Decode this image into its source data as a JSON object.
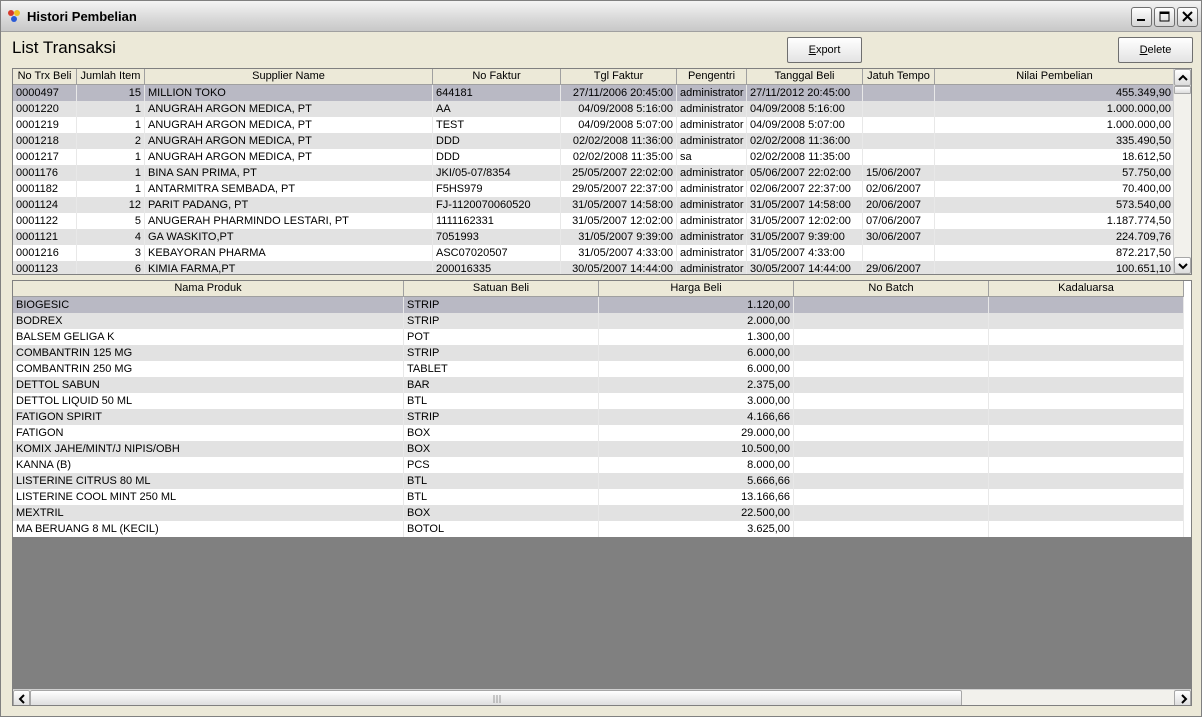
{
  "window": {
    "title": "Histori Pembelian"
  },
  "page": {
    "heading": "List Transaksi"
  },
  "buttons": {
    "export_label": "Export",
    "delete_label": "Delete"
  },
  "transactions": {
    "columns": [
      "No Trx Beli",
      "Jumlah Item",
      "Supplier Name",
      "No Faktur",
      "Tgl Faktur",
      "Pengentri",
      "Tanggal Beli",
      "Jatuh Tempo",
      "Nilai Pembelian"
    ],
    "rows": [
      [
        "0000497",
        "15",
        "MILLION TOKO",
        "644181",
        "27/11/2006 20:45:00",
        "administrator",
        "27/11/2012 20:45:00",
        "",
        "455.349,90"
      ],
      [
        "0001220",
        "1",
        "ANUGRAH ARGON MEDICA, PT",
        "AA",
        "04/09/2008 5:16:00",
        "administrator",
        "04/09/2008 5:16:00",
        "",
        "1.000.000,00"
      ],
      [
        "0001219",
        "1",
        "ANUGRAH ARGON MEDICA, PT",
        "TEST",
        "04/09/2008 5:07:00",
        "administrator",
        "04/09/2008 5:07:00",
        "",
        "1.000.000,00"
      ],
      [
        "0001218",
        "2",
        "ANUGRAH ARGON MEDICA, PT",
        "DDD",
        "02/02/2008 11:36:00",
        "administrator",
        "02/02/2008 11:36:00",
        "",
        "335.490,50"
      ],
      [
        "0001217",
        "1",
        "ANUGRAH ARGON MEDICA, PT",
        "DDD",
        "02/02/2008 11:35:00",
        "sa",
        "02/02/2008 11:35:00",
        "",
        "18.612,50"
      ],
      [
        "0001176",
        "1",
        "BINA SAN PRIMA, PT",
        "JKI/05-07/8354",
        "25/05/2007 22:02:00",
        "administrator",
        "05/06/2007 22:02:00",
        "15/06/2007",
        "57.750,00"
      ],
      [
        "0001182",
        "1",
        "ANTARMITRA SEMBADA, PT",
        "F5HS979",
        "29/05/2007 22:37:00",
        "administrator",
        "02/06/2007 22:37:00",
        "02/06/2007",
        "70.400,00"
      ],
      [
        "0001124",
        "12",
        "PARIT PADANG, PT",
        "FJ-1120070060520",
        "31/05/2007 14:58:00",
        "administrator",
        "31/05/2007 14:58:00",
        "20/06/2007",
        "573.540,00"
      ],
      [
        "0001122",
        "5",
        "ANUGERAH PHARMINDO LESTARI, PT",
        "1111162331",
        "31/05/2007 12:02:00",
        "administrator",
        "31/05/2007 12:02:00",
        "07/06/2007",
        "1.187.774,50"
      ],
      [
        "0001121",
        "4",
        "GA WASKITO,PT",
        "7051993",
        "31/05/2007 9:39:00",
        "administrator",
        "31/05/2007 9:39:00",
        "30/06/2007",
        "224.709,76"
      ],
      [
        "0001216",
        "3",
        "KEBAYORAN PHARMA",
        "ASC07020507",
        "31/05/2007 4:33:00",
        "administrator",
        "31/05/2007 4:33:00",
        "",
        "872.217,50"
      ],
      [
        "0001123",
        "6",
        "KIMIA FARMA,PT",
        "200016335",
        "30/05/2007 14:44:00",
        "administrator",
        "30/05/2007 14:44:00",
        "29/06/2007",
        "100.651,10"
      ]
    ]
  },
  "details": {
    "columns": [
      "Nama Produk",
      "Satuan Beli",
      "Harga Beli",
      "No Batch",
      "Kadaluarsa"
    ],
    "rows": [
      [
        "BIOGESIC",
        "STRIP",
        "1.120,00",
        "",
        ""
      ],
      [
        "BODREX",
        "STRIP",
        "2.000,00",
        "",
        ""
      ],
      [
        "BALSEM GELIGA K",
        "POT",
        "1.300,00",
        "",
        ""
      ],
      [
        "COMBANTRIN 125 MG",
        "STRIP",
        "6.000,00",
        "",
        ""
      ],
      [
        "COMBANTRIN 250 MG",
        "TABLET",
        "6.000,00",
        "",
        ""
      ],
      [
        "DETTOL SABUN",
        "BAR",
        "2.375,00",
        "",
        ""
      ],
      [
        "DETTOL LIQUID 50 ML",
        "BTL",
        "3.000,00",
        "",
        ""
      ],
      [
        "FATIGON SPIRIT",
        "STRIP",
        "4.166,66",
        "",
        ""
      ],
      [
        "FATIGON",
        "BOX",
        "29.000,00",
        "",
        ""
      ],
      [
        "KOMIX JAHE/MINT/J NIPIS/OBH",
        "BOX",
        "10.500,00",
        "",
        ""
      ],
      [
        "KANNA (B)",
        "PCS",
        "8.000,00",
        "",
        ""
      ],
      [
        "LISTERINE CITRUS 80 ML",
        "BTL",
        "5.666,66",
        "",
        ""
      ],
      [
        "LISTERINE COOL MINT 250 ML",
        "BTL",
        "13.166,66",
        "",
        ""
      ],
      [
        "MEXTRIL",
        "BOX",
        "22.500,00",
        "",
        ""
      ],
      [
        "MA BERUANG  8 ML (KECIL)",
        "BOTOL",
        "3.625,00",
        "",
        ""
      ]
    ]
  },
  "colors": {
    "selected_row": "#b9b9c4",
    "alt_row": "#e2e2e2",
    "empty_area": "#808080"
  }
}
